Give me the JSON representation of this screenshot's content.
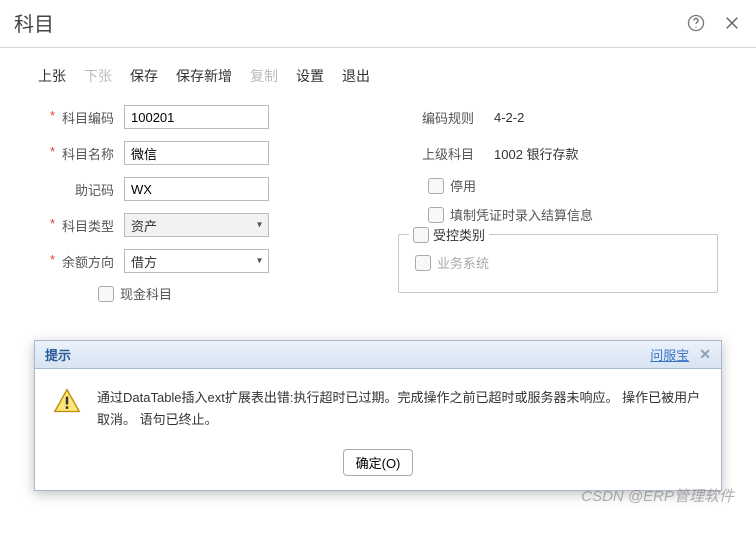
{
  "header": {
    "title": "科目"
  },
  "toolbar": {
    "prev": "上张",
    "next": "下张",
    "save": "保存",
    "saveNew": "保存新增",
    "copy": "复制",
    "settings": "设置",
    "exit": "退出"
  },
  "form": {
    "labels": {
      "code": "科目编码",
      "name": "科目名称",
      "mnemonic": "助记码",
      "type": "科目类型",
      "balanceDir": "余额方向",
      "codeRule": "编码规则",
      "parent": "上级科目"
    },
    "values": {
      "code": "100201",
      "name": "微信",
      "mnemonic": "WX",
      "type": "资产",
      "balanceDir": "借方",
      "codeRule": "4-2-2",
      "parent": "1002  银行存款"
    },
    "checkboxes": {
      "cashAccount": "现金科目",
      "disabled": "停用",
      "settleInfo": "填制凭证时录入结算信息"
    },
    "fieldset": {
      "legend": "受控类别",
      "bizSystem": "业务系统"
    }
  },
  "dialog": {
    "title": "提示",
    "link": "问服宝",
    "message": "通过DataTable插入ext扩展表出错:执行超时已过期。完成操作之前已超时或服务器未响应。 操作已被用户取消。 语句已终止。",
    "ok": "确定(O)"
  },
  "watermark": "CSDN @ERP管理软件"
}
